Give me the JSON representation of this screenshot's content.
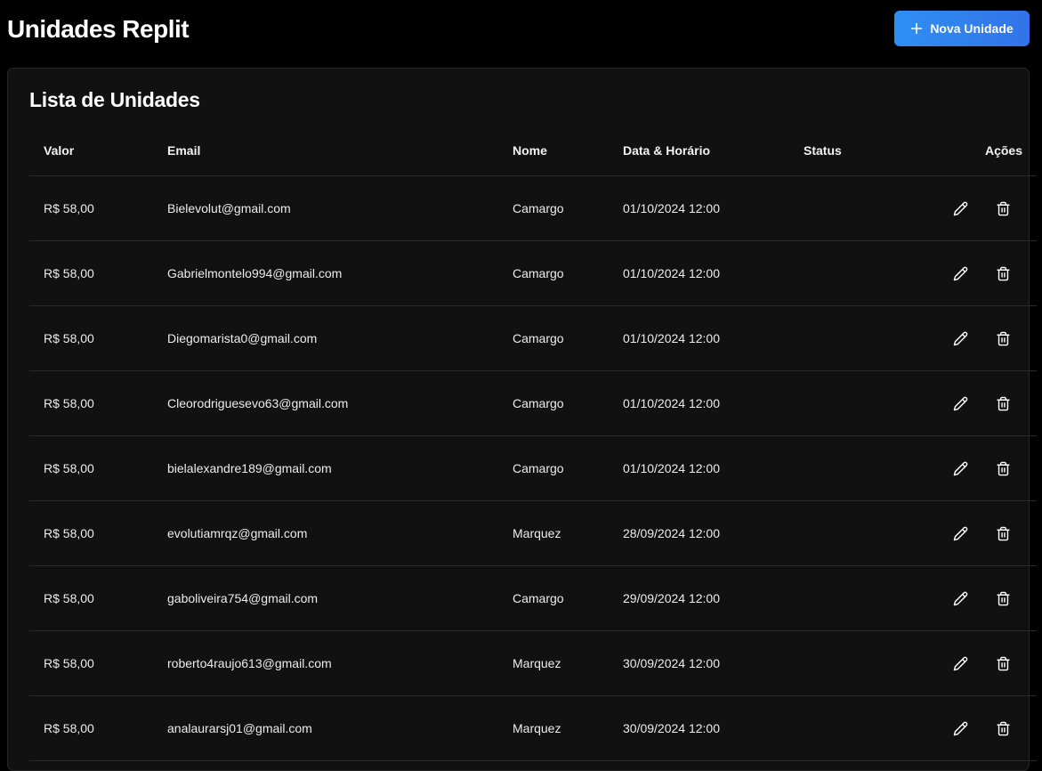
{
  "header": {
    "title": "Unidades Replit",
    "new_button_label": "Nova Unidade",
    "new_button_icon": "plus-icon"
  },
  "card": {
    "title": "Lista de Unidades"
  },
  "table": {
    "columns": {
      "valor": "Valor",
      "email": "Email",
      "nome": "Nome",
      "data": "Data & Horário",
      "status": "Status",
      "acoes": "Ações"
    },
    "rows": [
      {
        "valor": "R$ 58,00",
        "email": "Bielevolut@gmail.com",
        "nome": "Camargo",
        "data": "01/10/2024 12:00",
        "status": ""
      },
      {
        "valor": "R$ 58,00",
        "email": "Gabrielmontelo994@gmail.com",
        "nome": "Camargo",
        "data": "01/10/2024 12:00",
        "status": ""
      },
      {
        "valor": "R$ 58,00",
        "email": "Diegomarista0@gmail.com",
        "nome": "Camargo",
        "data": "01/10/2024 12:00",
        "status": ""
      },
      {
        "valor": "R$ 58,00",
        "email": "Cleorodriguesevo63@gmail.com",
        "nome": "Camargo",
        "data": "01/10/2024 12:00",
        "status": ""
      },
      {
        "valor": "R$ 58,00",
        "email": "bielalexandre189@gmail.com",
        "nome": "Camargo",
        "data": "01/10/2024 12:00",
        "status": ""
      },
      {
        "valor": "R$ 58,00",
        "email": "evolutiamrqz@gmail.com",
        "nome": "Marquez",
        "data": "28/09/2024 12:00",
        "status": ""
      },
      {
        "valor": "R$ 58,00",
        "email": "gaboliveira754@gmail.com",
        "nome": "Camargo",
        "data": "29/09/2024 12:00",
        "status": ""
      },
      {
        "valor": "R$ 58,00",
        "email": "roberto4raujo613@gmail.com",
        "nome": "Marquez",
        "data": "30/09/2024 12:00",
        "status": ""
      },
      {
        "valor": "R$ 58,00",
        "email": "analaurarsj01@gmail.com",
        "nome": "Marquez",
        "data": "30/09/2024 12:00",
        "status": ""
      }
    ],
    "row_action_icons": [
      "pencil-icon",
      "trash-icon"
    ]
  },
  "colors": {
    "background": "#000000",
    "card_background": "#111111",
    "accent_gradient_start": "#2f8ff3",
    "accent_gradient_end": "#3273e8",
    "divider": "#2a2a2a"
  }
}
